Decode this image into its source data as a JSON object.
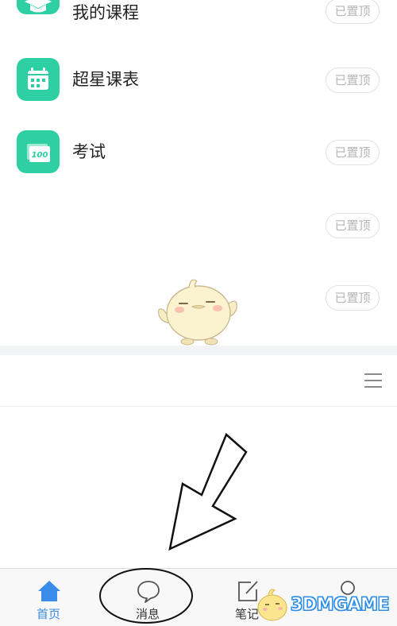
{
  "rows": [
    {
      "label": "我的课程",
      "icon": "graduation-cap-icon",
      "pin": "已置顶"
    },
    {
      "label": "超星课表",
      "icon": "calendar-icon",
      "pin": "已置顶"
    },
    {
      "label": "考试",
      "icon": "exam-100-icon",
      "icon_text": "100",
      "pin": "已置顶"
    },
    {
      "label": "",
      "pin": "已置顶"
    },
    {
      "label": "",
      "pin": "已置顶"
    }
  ],
  "section_header": {
    "menu_icon": "menu-lines-icon"
  },
  "tabs": [
    {
      "label": "首页",
      "icon": "home-icon",
      "active": true
    },
    {
      "label": "消息",
      "icon": "chat-bubble-icon",
      "active": false
    },
    {
      "label": "笔记",
      "icon": "note-edit-icon",
      "active": false
    },
    {
      "label": "",
      "icon": "profile-icon",
      "active": false
    }
  ],
  "watermark": {
    "text": "3DMGAME"
  },
  "colors": {
    "accent_green": "#2ecfa3",
    "tab_active": "#3a8bea",
    "badge_text": "#b5b5b5",
    "separator": "#f2f3f5"
  }
}
